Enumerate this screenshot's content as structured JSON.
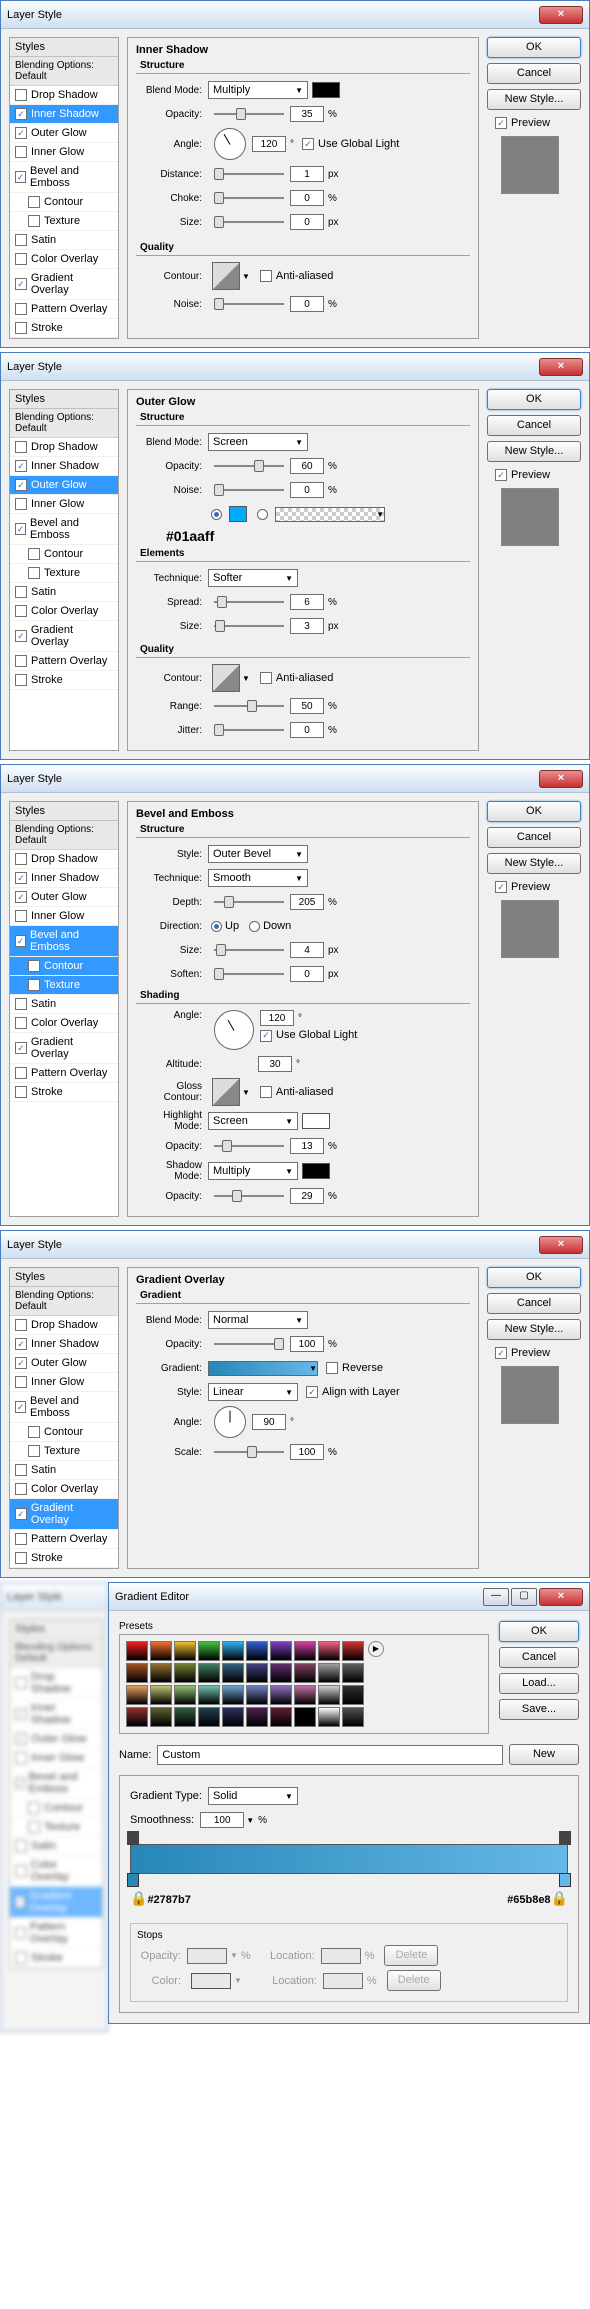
{
  "dialogs": {
    "title": "Layer Style",
    "close": "×",
    "styles_header": "Styles",
    "blending_header": "Blending Options: Default",
    "style_items": [
      "Drop Shadow",
      "Inner Shadow",
      "Outer Glow",
      "Inner Glow",
      "Bevel and Emboss",
      "Contour",
      "Texture",
      "Satin",
      "Color Overlay",
      "Gradient Overlay",
      "Pattern Overlay",
      "Stroke"
    ],
    "buttons": {
      "ok": "OK",
      "cancel": "Cancel",
      "newstyle": "New Style...",
      "preview": "Preview"
    }
  },
  "inner_shadow": {
    "title": "Inner Shadow",
    "structure": "Structure",
    "blend_mode_label": "Blend Mode:",
    "blend_mode": "Multiply",
    "opacity_label": "Opacity:",
    "opacity": "35",
    "angle_label": "Angle:",
    "angle": "120",
    "use_global": "Use Global Light",
    "distance_label": "Distance:",
    "distance": "1",
    "choke_label": "Choke:",
    "choke": "0",
    "size_label": "Size:",
    "size": "0",
    "quality": "Quality",
    "contour_label": "Contour:",
    "antialiased": "Anti-aliased",
    "noise_label": "Noise:",
    "noise": "0",
    "pct": "%",
    "px": "px",
    "deg": "°"
  },
  "outer_glow": {
    "title": "Outer Glow",
    "structure": "Structure",
    "blend_mode_label": "Blend Mode:",
    "blend_mode": "Screen",
    "opacity_label": "Opacity:",
    "opacity": "60",
    "noise_label": "Noise:",
    "noise": "0",
    "color_annotation": "#01aaff",
    "elements": "Elements",
    "technique_label": "Technique:",
    "technique": "Softer",
    "spread_label": "Spread:",
    "spread": "6",
    "size_label": "Size:",
    "size": "3",
    "quality": "Quality",
    "contour_label": "Contour:",
    "antialiased": "Anti-aliased",
    "range_label": "Range:",
    "range": "50",
    "jitter_label": "Jitter:",
    "jitter": "0",
    "pct": "%",
    "px": "px"
  },
  "bevel": {
    "title": "Bevel and Emboss",
    "structure": "Structure",
    "style_label": "Style:",
    "style": "Outer Bevel",
    "technique_label": "Technique:",
    "technique": "Smooth",
    "depth_label": "Depth:",
    "depth": "205",
    "direction_label": "Direction:",
    "up": "Up",
    "down": "Down",
    "size_label": "Size:",
    "size": "4",
    "soften_label": "Soften:",
    "soften": "0",
    "shading": "Shading",
    "angle_label": "Angle:",
    "angle": "120",
    "use_global": "Use Global Light",
    "altitude_label": "Altitude:",
    "altitude": "30",
    "gloss_label": "Gloss Contour:",
    "antialiased": "Anti-aliased",
    "highlight_label": "Highlight Mode:",
    "highlight": "Screen",
    "h_opacity_label": "Opacity:",
    "h_opacity": "13",
    "shadow_label": "Shadow Mode:",
    "shadow": "Multiply",
    "s_opacity_label": "Opacity:",
    "s_opacity": "29",
    "pct": "%",
    "px": "px",
    "deg": "°"
  },
  "gradient_overlay": {
    "title": "Gradient Overlay",
    "gradient_h": "Gradient",
    "blend_mode_label": "Blend Mode:",
    "blend_mode": "Normal",
    "opacity_label": "Opacity:",
    "opacity": "100",
    "gradient_label": "Gradient:",
    "reverse": "Reverse",
    "style_label": "Style:",
    "style": "Linear",
    "align": "Align with Layer",
    "angle_label": "Angle:",
    "angle": "90",
    "scale_label": "Scale:",
    "scale": "100",
    "pct": "%",
    "deg": "°"
  },
  "gradient_editor": {
    "title": "Gradient Editor",
    "presets": "Presets",
    "name_label": "Name:",
    "name": "Custom",
    "new_btn": "New",
    "ok": "OK",
    "cancel": "Cancel",
    "load": "Load...",
    "save": "Save...",
    "grad_type_label": "Gradient Type:",
    "grad_type": "Solid",
    "smoothness_label": "Smoothness:",
    "smoothness": "100",
    "pct": "%",
    "color_left": "#2787b7",
    "color_right": "#65b8e8",
    "stops": "Stops",
    "opacity_label": "Opacity:",
    "location_label": "Location:",
    "color_label": "Color:",
    "delete": "Delete",
    "preset_colors": [
      "#f02020",
      "#f07030",
      "#f0c030",
      "#40c040",
      "#30b0f0",
      "#3060d0",
      "#8040c0",
      "#d040a0",
      "#f06080",
      "#d03030",
      "#a05020",
      "#907030",
      "#708030",
      "#408060",
      "#306080",
      "#404080",
      "#603070",
      "#804060",
      "#a0a0a0",
      "#606060",
      "#e0a060",
      "#c0c070",
      "#90c070",
      "#70c0b0",
      "#70a0d0",
      "#7080c0",
      "#9070c0",
      "#c070a0",
      "#d0d0d0",
      "#303030",
      "#903030",
      "#606030",
      "#306040",
      "#204050",
      "#303060",
      "#502050",
      "#602030",
      "#000000",
      "#ffffff",
      "#505050"
    ]
  }
}
